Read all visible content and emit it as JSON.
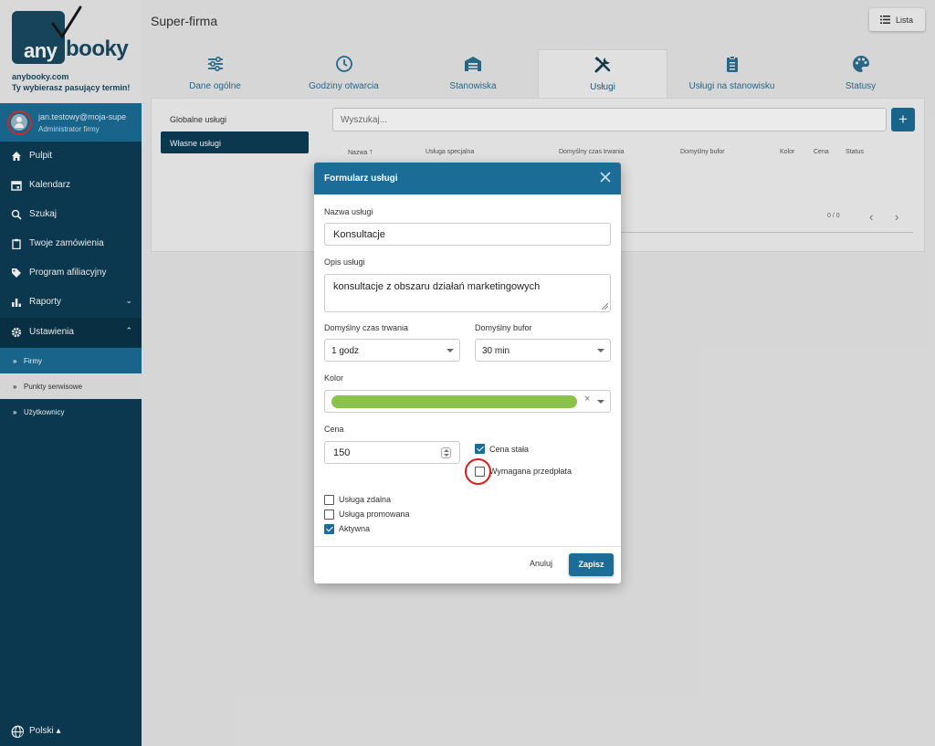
{
  "brand": {
    "logo_any": "any",
    "logo_booky": "booky",
    "url": "anybooky.com",
    "tagline": "Ty wybierasz pasujący termin!"
  },
  "user": {
    "email": "jan.testowy@moja-supe",
    "role": "Administrator firmy"
  },
  "nav": {
    "pulpit": "Pulpit",
    "kalendarz": "Kalendarz",
    "szukaj": "Szukaj",
    "zamowienia": "Twoje zamówienia",
    "afiliacyjny": "Program afiliacyjny",
    "raporty": "Raporty",
    "ustawienia": "Ustawienia",
    "sub_firmy": "Firmy",
    "sub_punkty": "Punkty serwisowe",
    "sub_uzytkownicy": "Użytkownicy"
  },
  "language": "Polski ▴",
  "header": {
    "company": "Super-firma",
    "list_button": "Lista"
  },
  "tabs": {
    "dane": "Dane ogólne",
    "godziny": "Godziny otwarcia",
    "stanowiska": "Stanowiska",
    "uslugi": "Usługi",
    "uslugi_stanowisku": "Usługi na stanowisku",
    "statusy": "Statusy"
  },
  "services_menu": {
    "global": "Globalne usługi",
    "own": "Własne usługi"
  },
  "search": {
    "placeholder": "Wyszukaj..."
  },
  "add_button": "+",
  "table": {
    "headers": {
      "nazwa": "Nazwa 🡑",
      "specjalna": "Usługa specjalna",
      "czas": "Domyślny czas trwania",
      "bufor": "Domyślny bufor",
      "kolor": "Kolor",
      "cena": "Cena",
      "status": "Status"
    },
    "pager": "0 / 0",
    "prev": "‹",
    "next": "›"
  },
  "modal": {
    "title": "Formularz usługi",
    "name_label": "Nazwa usługi",
    "name_value": "Konsultacje",
    "desc_label": "Opis usługi",
    "desc_value": "konsultacje z obszaru działań marketingowych",
    "duration_label": "Domyślny czas trwania",
    "duration_value": "1 godz",
    "buffer_label": "Domyślny bufor",
    "buffer_value": "30 min",
    "color_label": "Kolor",
    "color_value": "#8bc34a",
    "color_clear": "×",
    "price_label": "Cena",
    "price_value": "150",
    "fixed_price_label": "Cena stała",
    "fixed_price_checked": true,
    "prepayment_label": "Wymagana przedpłata",
    "prepayment_checked": false,
    "remote_label": "Usługa zdalna",
    "remote_checked": false,
    "promoted_label": "Usługa promowana",
    "promoted_checked": false,
    "active_label": "Aktywna",
    "active_checked": true,
    "cancel_label": "Anuluj",
    "save_label": "Zapisz"
  },
  "colors": {
    "sidebar": "#0d3d56",
    "accent": "#1b6d97",
    "highlight_ring": "#e01818"
  }
}
